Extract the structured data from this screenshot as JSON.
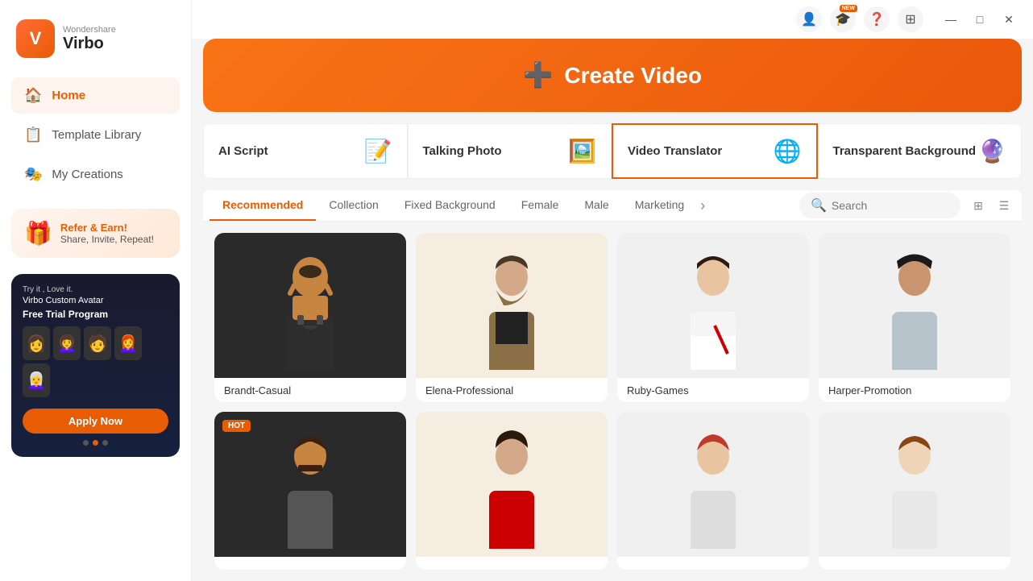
{
  "app": {
    "brand": "Wondershare",
    "name": "Virbo"
  },
  "sidebar": {
    "nav_items": [
      {
        "id": "home",
        "label": "Home",
        "icon": "🏠",
        "active": true
      },
      {
        "id": "template-library",
        "label": "Template Library",
        "icon": "📋",
        "active": false
      },
      {
        "id": "my-creations",
        "label": "My Creations",
        "icon": "🎭",
        "active": false
      }
    ],
    "refer_banner": {
      "icon": "🎁",
      "title": "Refer & Earn!",
      "subtitle": "Share, Invite, Repeat!"
    },
    "promo": {
      "try_text": "Try it , Love it.",
      "title": "Virbo Custom Avatar",
      "free_text": "Free Trial Program",
      "apply_label": "Apply Now"
    }
  },
  "titlebar": {
    "icons": [
      "👤",
      "🎓",
      "❓",
      "⊞"
    ],
    "new_badge": "NEW",
    "window_controls": [
      "—",
      "□",
      "✕"
    ]
  },
  "create_video": {
    "icon": "➕",
    "label": "Create Video"
  },
  "tool_cards": [
    {
      "id": "ai-script",
      "label": "AI Script",
      "icon": "📝",
      "active": false
    },
    {
      "id": "talking-photo",
      "label": "Talking Photo",
      "icon": "🖼️",
      "active": false
    },
    {
      "id": "video-translator",
      "label": "Video Translator",
      "icon": "🌐",
      "active": true
    },
    {
      "id": "transparent-background",
      "label": "Transparent Background",
      "icon": "🔮",
      "active": false
    }
  ],
  "filter_tabs": [
    {
      "id": "recommended",
      "label": "Recommended",
      "active": true
    },
    {
      "id": "collection",
      "label": "Collection",
      "active": false
    },
    {
      "id": "fixed-background",
      "label": "Fixed Background",
      "active": false
    },
    {
      "id": "female",
      "label": "Female",
      "active": false
    },
    {
      "id": "male",
      "label": "Male",
      "active": false
    },
    {
      "id": "marketing",
      "label": "Marketing",
      "active": false
    }
  ],
  "search": {
    "placeholder": "Search"
  },
  "avatars": [
    {
      "id": "brandt-casual",
      "name": "Brandt-Casual",
      "bg": "dark-bg",
      "emoji": "🧑‍💼",
      "hot": false
    },
    {
      "id": "elena-professional",
      "name": "Elena-Professional",
      "bg": "cream-bg",
      "emoji": "👩‍💼",
      "hot": false
    },
    {
      "id": "ruby-games",
      "name": "Ruby-Games",
      "bg": "light-bg",
      "emoji": "👩‍🎮",
      "hot": false
    },
    {
      "id": "harper-promotion",
      "name": "Harper-Promotion",
      "bg": "light-bg",
      "emoji": "👩‍🏫",
      "hot": false
    },
    {
      "id": "avatar-5",
      "name": "",
      "bg": "dark-bg",
      "emoji": "🧔",
      "hot": true
    },
    {
      "id": "avatar-6",
      "name": "",
      "bg": "cream-bg",
      "emoji": "👩‍🦱",
      "hot": false
    },
    {
      "id": "avatar-7",
      "name": "",
      "bg": "light-bg",
      "emoji": "👩‍🦰",
      "hot": false
    },
    {
      "id": "avatar-8",
      "name": "",
      "bg": "light-bg",
      "emoji": "👩",
      "hot": false
    }
  ],
  "colors": {
    "brand_orange": "#e85d04",
    "active_border": "#e85d04",
    "sidebar_bg": "#ffffff",
    "main_bg": "#f5f5f5"
  }
}
